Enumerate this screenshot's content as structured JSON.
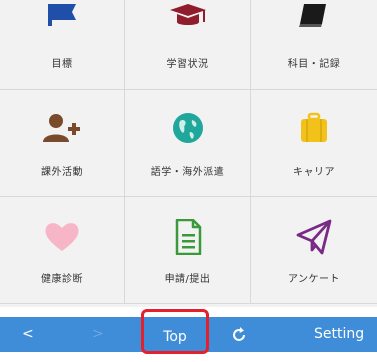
{
  "menu": [
    {
      "label": "目標",
      "icon": "flag-icon",
      "color": "#1f4fa8"
    },
    {
      "label": "学習状況",
      "icon": "graduation-cap-icon",
      "color": "#8f1d2c"
    },
    {
      "label": "科目・記録",
      "icon": "notebook-icon",
      "color": "#1a1a1a"
    },
    {
      "label": "課外活動",
      "icon": "person-add-icon",
      "color": "#7a4b2a"
    },
    {
      "label": "語学・海外派遣",
      "icon": "globe-icon",
      "color": "#1ea79a"
    },
    {
      "label": "キャリア",
      "icon": "briefcase-icon",
      "color": "#f2c21b"
    },
    {
      "label": "健康診断",
      "icon": "heart-icon",
      "color": "#f6b6c8"
    },
    {
      "label": "申請/提出",
      "icon": "document-icon",
      "color": "#3a9a3a"
    },
    {
      "label": "アンケート",
      "icon": "paper-plane-icon",
      "color": "#7a2a86"
    }
  ],
  "toolbar": {
    "back": "<",
    "forward": ">",
    "top": "Top",
    "reload_icon": "reload-icon",
    "setting": "Setting",
    "bg_color": "#3f8cd8",
    "highlight_color": "#e6202a"
  }
}
